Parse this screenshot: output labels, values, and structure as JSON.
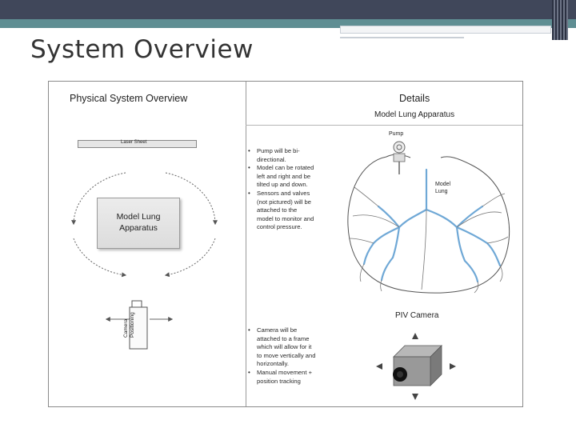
{
  "slide": {
    "title": "System Overview"
  },
  "figure": {
    "left_panel": {
      "heading": "Physical System Overview",
      "laser_sheet_label": "Laser Sheet",
      "model_box_line1": "Model Lung",
      "model_box_line2": "Apparatus",
      "camera_label_line1": "Camera",
      "camera_label_line2": "Positioning"
    },
    "right_panel": {
      "heading": "Details",
      "subheading": "Model Lung Apparatus",
      "pump_label": "Pump",
      "model_lung_label_line1": "Model",
      "model_lung_label_line2": "Lung",
      "camera_heading": "PIV Camera",
      "lung_bullets": [
        "Pump will be bi-directional.",
        "Model can be rotated left and right and be tilted up and down.",
        "Sensors and valves (not pictured) will be attached to the model to monitor and control pressure."
      ],
      "camera_bullets": [
        "Camera will be attached to a frame which will allow for it to move vertically and horizontally.",
        "Manual movement + position tracking"
      ]
    }
  },
  "colors": {
    "header_dark": "#40475a",
    "header_teal": "#5f8e93",
    "airway_blue": "#6fa8d6"
  }
}
